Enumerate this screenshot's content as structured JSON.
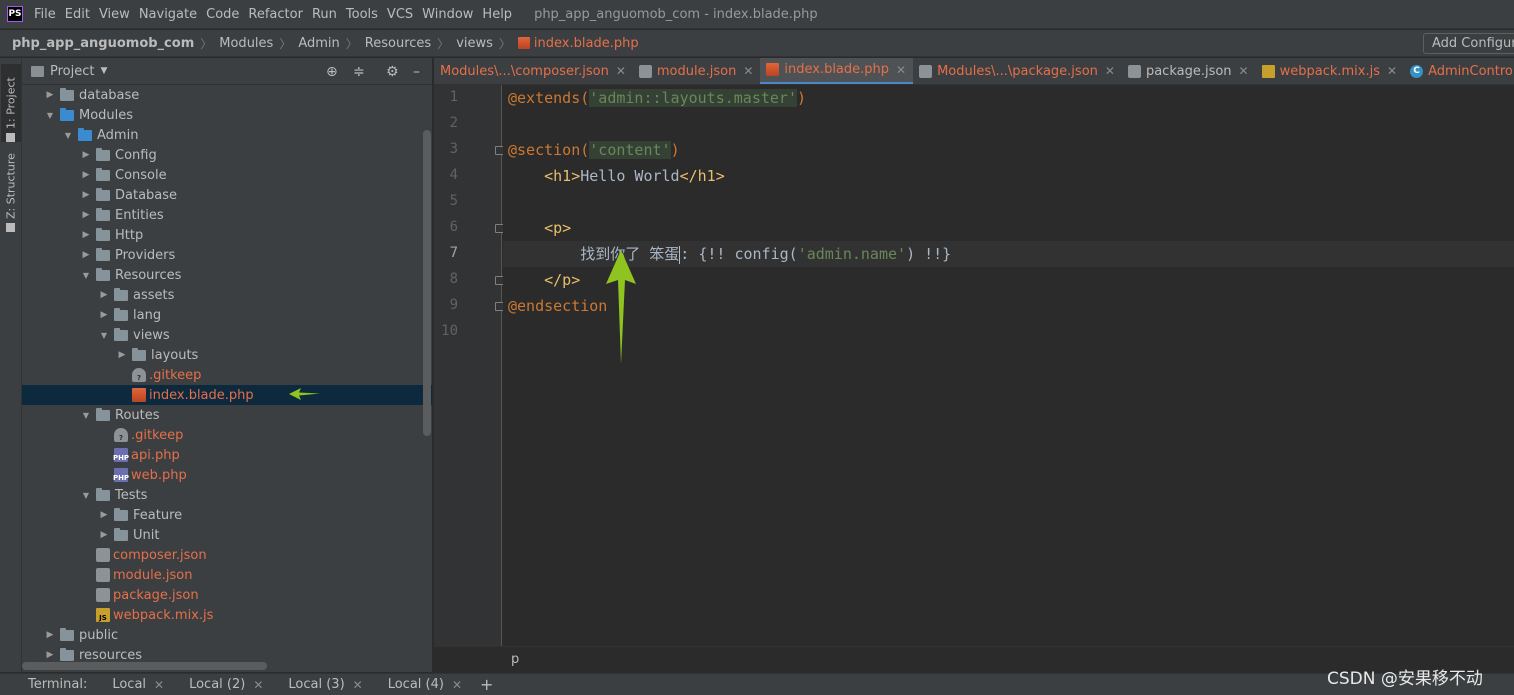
{
  "menubar": {
    "logo": "PS",
    "items": [
      "File",
      "Edit",
      "View",
      "Navigate",
      "Code",
      "Refactor",
      "Run",
      "Tools",
      "VCS",
      "Window",
      "Help"
    ],
    "window_title": "php_app_anguomob_com - index.blade.php"
  },
  "breadcrumb": {
    "items": [
      "php_app_anguomob_com",
      "Modules",
      "Admin",
      "Resources",
      "views"
    ],
    "file": "index.blade.php",
    "add_configuration": "Add Configuration..."
  },
  "left_strip": {
    "project_tab": "1: Project",
    "structure_tab": "Z: Structure"
  },
  "project_panel": {
    "title": "Project",
    "tree": [
      {
        "label": "database",
        "type": "folder",
        "arrow": "right",
        "depth": 1
      },
      {
        "label": "Modules",
        "type": "folder-blue",
        "arrow": "down",
        "depth": 1
      },
      {
        "label": "Admin",
        "type": "folder-blue",
        "arrow": "down",
        "depth": 2
      },
      {
        "label": "Config",
        "type": "folder",
        "arrow": "right",
        "depth": 3
      },
      {
        "label": "Console",
        "type": "folder",
        "arrow": "right",
        "depth": 3
      },
      {
        "label": "Database",
        "type": "folder",
        "arrow": "right",
        "depth": 3
      },
      {
        "label": "Entities",
        "type": "folder",
        "arrow": "right",
        "depth": 3
      },
      {
        "label": "Http",
        "type": "folder",
        "arrow": "right",
        "depth": 3
      },
      {
        "label": "Providers",
        "type": "folder",
        "arrow": "right",
        "depth": 3
      },
      {
        "label": "Resources",
        "type": "folder",
        "arrow": "down",
        "depth": 3
      },
      {
        "label": "assets",
        "type": "folder",
        "arrow": "right",
        "depth": 4
      },
      {
        "label": "lang",
        "type": "folder",
        "arrow": "right",
        "depth": 4
      },
      {
        "label": "views",
        "type": "folder",
        "arrow": "down",
        "depth": 4
      },
      {
        "label": "layouts",
        "type": "folder",
        "arrow": "right",
        "depth": 5
      },
      {
        "label": ".gitkeep",
        "type": "git",
        "arrow": "none",
        "depth": 5,
        "red": true
      },
      {
        "label": "index.blade.php",
        "type": "blade",
        "arrow": "none",
        "depth": 5,
        "red": true,
        "selected": true
      },
      {
        "label": "Routes",
        "type": "folder",
        "arrow": "down",
        "depth": 3
      },
      {
        "label": ".gitkeep",
        "type": "git",
        "arrow": "none",
        "depth": 4,
        "red": true
      },
      {
        "label": "api.php",
        "type": "php",
        "arrow": "none",
        "depth": 4,
        "red": true
      },
      {
        "label": "web.php",
        "type": "php",
        "arrow": "none",
        "depth": 4,
        "red": true
      },
      {
        "label": "Tests",
        "type": "folder",
        "arrow": "down",
        "depth": 3
      },
      {
        "label": "Feature",
        "type": "folder",
        "arrow": "right",
        "depth": 4
      },
      {
        "label": "Unit",
        "type": "folder",
        "arrow": "right",
        "depth": 4
      },
      {
        "label": "composer.json",
        "type": "json",
        "arrow": "none",
        "depth": 3,
        "red": true
      },
      {
        "label": "module.json",
        "type": "json",
        "arrow": "none",
        "depth": 3,
        "red": true
      },
      {
        "label": "package.json",
        "type": "json",
        "arrow": "none",
        "depth": 3,
        "red": true
      },
      {
        "label": "webpack.mix.js",
        "type": "js",
        "arrow": "none",
        "depth": 3,
        "red": true
      },
      {
        "label": "public",
        "type": "folder",
        "arrow": "right",
        "depth": 1
      },
      {
        "label": "resources",
        "type": "folder",
        "arrow": "right",
        "depth": 1
      }
    ]
  },
  "editor_tabs": [
    {
      "label": "Modules\\...\\composer.json",
      "icon": "none",
      "style": "red",
      "closable": true
    },
    {
      "label": "module.json",
      "icon": "json",
      "style": "red",
      "closable": true
    },
    {
      "label": "index.blade.php",
      "icon": "blade",
      "style": "red",
      "closable": true,
      "active": true
    },
    {
      "label": "Modules\\...\\package.json",
      "icon": "json",
      "style": "red",
      "closable": true
    },
    {
      "label": "package.json",
      "icon": "json",
      "style": "plain",
      "closable": true
    },
    {
      "label": "webpack.mix.js",
      "icon": "js",
      "style": "red",
      "closable": true
    },
    {
      "label": "AdminController.php",
      "icon": "cls",
      "style": "red",
      "closable": false
    }
  ],
  "editor": {
    "line_numbers": [
      "1",
      "2",
      "3",
      "4",
      "5",
      "6",
      "7",
      "8",
      "9",
      "10"
    ],
    "current_line": 7,
    "lines": [
      [
        {
          "t": "@extends(",
          "c": "dir"
        },
        {
          "t": "'admin::layouts.master'",
          "c": "str"
        },
        {
          "t": ")",
          "c": "dir"
        }
      ],
      [],
      [
        {
          "t": "@section(",
          "c": "dir"
        },
        {
          "t": "'content'",
          "c": "str"
        },
        {
          "t": ")",
          "c": "dir"
        }
      ],
      [
        {
          "t": "    ",
          "c": "txt"
        },
        {
          "t": "<h1>",
          "c": "tag"
        },
        {
          "t": "Hello World",
          "c": "txt"
        },
        {
          "t": "</h1>",
          "c": "tag"
        }
      ],
      [],
      [
        {
          "t": "    ",
          "c": "txt"
        },
        {
          "t": "<p>",
          "c": "tag"
        }
      ],
      [
        {
          "t": "        找到你了 笨蛋",
          "c": "txt"
        },
        {
          "t": "CARET",
          "c": "caret"
        },
        {
          "t": ": {!! config(",
          "c": "txt"
        },
        {
          "t": "'admin.name'",
          "c": "str2"
        },
        {
          "t": ") !!}",
          "c": "txt"
        }
      ],
      [
        {
          "t": "    ",
          "c": "txt"
        },
        {
          "t": "</p>",
          "c": "tag"
        }
      ],
      [
        {
          "t": "@endsection",
          "c": "dir"
        }
      ],
      []
    ]
  },
  "editor_breadcrumb": "p",
  "bottom_bar": {
    "label": "Terminal:",
    "tabs": [
      "Local",
      "Local (2)",
      "Local (3)",
      "Local (4)"
    ],
    "add": "+"
  },
  "watermark": "CSDN @安果移不动",
  "colors": {
    "annotation_arrow": "#8fc31f",
    "accent": "#4a88c7"
  }
}
